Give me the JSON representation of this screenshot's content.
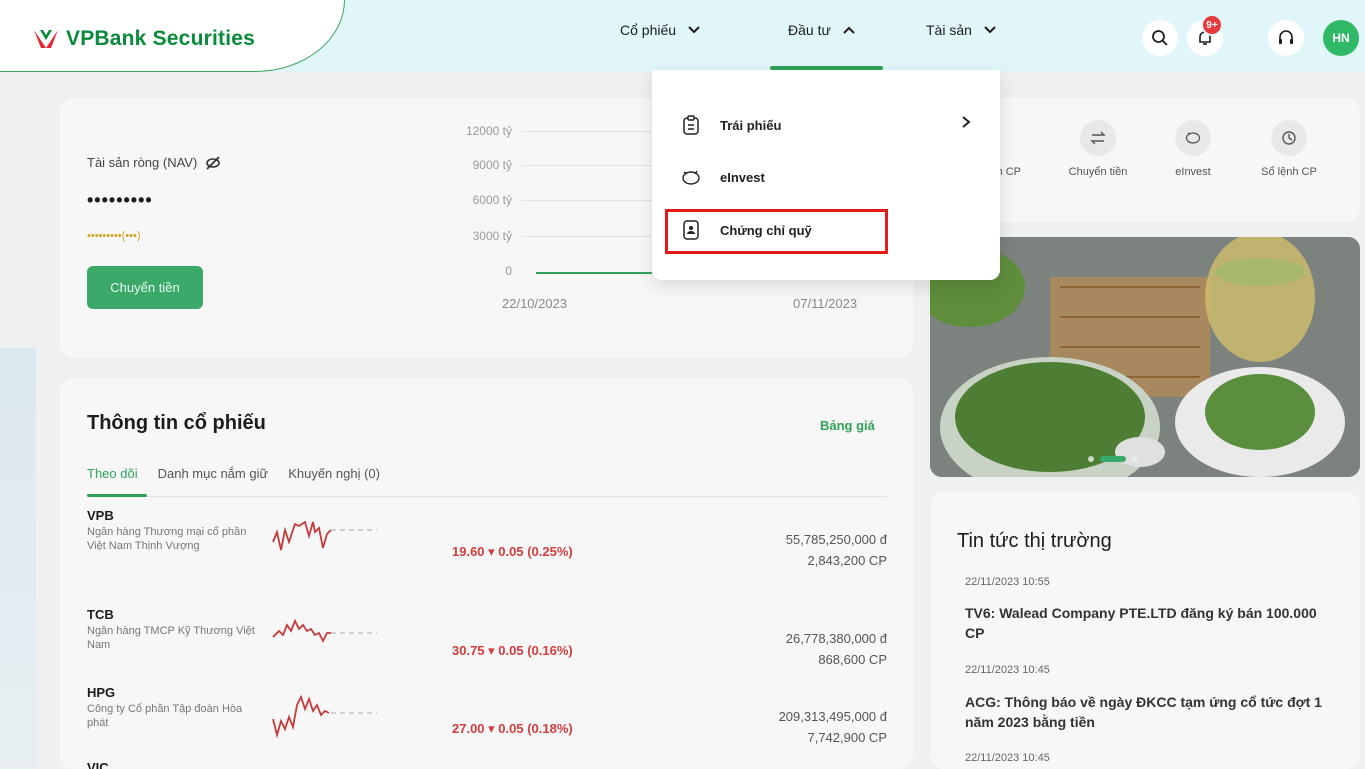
{
  "header": {
    "brand": "VPBank Securities",
    "nav": {
      "stocks": "Cổ phiếu",
      "invest": "Đầu tư",
      "assets": "Tài sản"
    },
    "notification_badge": "9+",
    "avatar_initials": "HN"
  },
  "invest_menu": {
    "items": [
      {
        "label": "Trái phiếu",
        "icon": "clipboard-icon"
      },
      {
        "label": "eInvest",
        "icon": "piggy-bank-icon"
      },
      {
        "label": "Chứng chỉ quỹ",
        "icon": "certificate-icon"
      }
    ]
  },
  "nav_card": {
    "label": "Tài sản ròng (NAV)",
    "masked_value": "•••••••••",
    "masked_change": "•••••••••(•••)",
    "transfer_button": "Chuyển tiền",
    "y_ticks": [
      "12000 tỷ",
      "9000 tỷ",
      "6000 tỷ",
      "3000 tỷ",
      "0"
    ],
    "x_ticks": [
      "22/10/2023",
      "07/11/2023"
    ]
  },
  "quick_actions": [
    {
      "label": "...lệnh CP",
      "icon": "hammer-icon"
    },
    {
      "label": "Chuyển tiền",
      "icon": "transfer-icon"
    },
    {
      "label": "eInvest",
      "icon": "piggy-bank-icon"
    },
    {
      "label": "Sổ lệnh CP",
      "icon": "history-icon"
    }
  ],
  "stock_info": {
    "title": "Thông tin cổ phiếu",
    "price_board_link": "Bảng giá",
    "tabs": [
      "Theo dõi",
      "Danh mục nắm giữ",
      "Khuyến nghị (0)"
    ],
    "rows": [
      {
        "symbol": "VPB",
        "company": "Ngân hàng Thương mại cổ phần Việt Nam Thịnh Vượng",
        "price": "19.60 ▾ 0.05 (0.25%)",
        "value": "55,785,250,000 đ",
        "volume": "2,843,200 CP"
      },
      {
        "symbol": "TCB",
        "company": "Ngân hàng TMCP Kỹ Thương Việt Nam",
        "price": "30.75 ▾ 0.05 (0.16%)",
        "value": "26,778,380,000 đ",
        "volume": "868,600 CP"
      },
      {
        "symbol": "HPG",
        "company": "Công ty Cổ phần Tập đoàn Hòa phát",
        "price": "27.00 ▾ 0.05 (0.18%)",
        "value": "209,313,495,000 đ",
        "volume": "7,742,900 CP"
      },
      {
        "symbol": "VIC",
        "company": "",
        "price": "",
        "value": "",
        "volume": ""
      }
    ]
  },
  "news": {
    "title": "Tin tức thị trường",
    "items": [
      {
        "time": "22/11/2023 10:55",
        "headline": "TV6: Walead Company PTE.LTD đăng ký bán 100.000 CP"
      },
      {
        "time": "22/11/2023 10:45",
        "headline": "ACG: Thông báo về ngày ĐKCC tạm ứng cổ tức đợt 1 năm 2023 bằng tiền"
      },
      {
        "time": "22/11/2023 10:45",
        "headline": ""
      }
    ]
  },
  "colors": {
    "brand_green": "#0a8a3a",
    "accent_green": "#2fa25a",
    "down_red": "#d43c3c",
    "highlight_red": "#e11b1b"
  }
}
